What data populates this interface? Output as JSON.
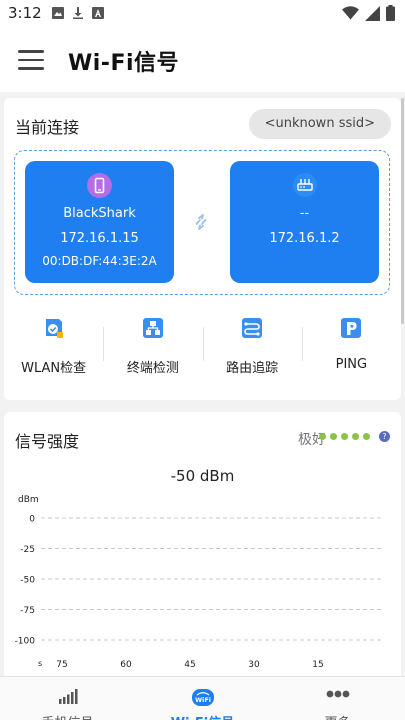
{
  "status_bar": {
    "time": "3:12"
  },
  "app_bar": {
    "title": "Wi-Fi信号"
  },
  "connection": {
    "label": "当前连接",
    "ssid": "<unknown ssid>",
    "local": {
      "name": "BlackShark",
      "ip": "172.16.1.15",
      "mac": "00:DB:DF:44:3E:2A"
    },
    "router": {
      "name": "--",
      "ip": "172.16.1.2"
    }
  },
  "tools": [
    {
      "label": "WLAN检查",
      "icon": "wlan-check-icon"
    },
    {
      "label": "终端检测",
      "icon": "terminal-detect-icon"
    },
    {
      "label": "路由追踪",
      "icon": "route-trace-icon"
    },
    {
      "label": "PING",
      "icon": "ping-icon"
    }
  ],
  "signal": {
    "title": "信号强度",
    "quality": "极好",
    "quality_dots": 5,
    "value": "-50  dBm"
  },
  "chart_data": {
    "type": "line",
    "ylabel": "dBm",
    "xlabel": "s",
    "yticks": [
      "0",
      "-25",
      "-50",
      "-75",
      "-100"
    ],
    "ylim": [
      -100,
      0
    ],
    "xticks": [
      "75",
      "60",
      "45",
      "30",
      "15"
    ],
    "grid": true,
    "series": []
  },
  "bottom_nav": [
    {
      "label": "手机信号",
      "icon": "signal-bars-icon",
      "active": false
    },
    {
      "label": "Wi-Fi信号",
      "icon": "wifi-badge-icon",
      "active": true
    },
    {
      "label": "更多",
      "icon": "more-dots-icon",
      "active": false
    }
  ],
  "colors": {
    "accent": "#1f7ff1",
    "good": "#8bc34a"
  }
}
